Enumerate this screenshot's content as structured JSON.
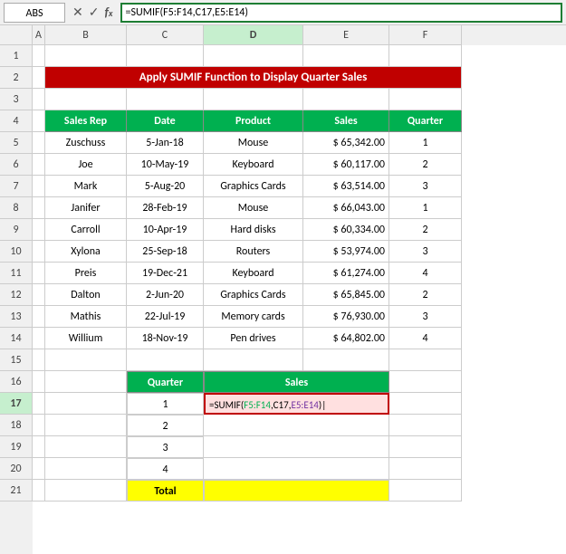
{
  "formulaBar": {
    "nameBox": "ABS",
    "formula": "=SUMIF(F5:F14,C17,E5:E14)"
  },
  "title": "Apply SUMIF Function to Display Quarter Sales",
  "columns": [
    "A",
    "B",
    "C",
    "D",
    "E",
    "F"
  ],
  "headers": {
    "salesRep": "Sales Rep",
    "date": "Date",
    "product": "Product",
    "sales": "Sales",
    "quarter": "Quarter"
  },
  "rows": [
    {
      "salesRep": "Zuschuss",
      "date": "5-Jan-18",
      "product": "Mouse",
      "sales": "$ 65,342.00",
      "quarter": "1"
    },
    {
      "salesRep": "Joe",
      "date": "10-May-19",
      "product": "Keyboard",
      "sales": "$ 60,117.00",
      "quarter": "2"
    },
    {
      "salesRep": "Mark",
      "date": "5-Aug-20",
      "product": "Graphics Cards",
      "sales": "$ 63,514.00",
      "quarter": "3"
    },
    {
      "salesRep": "Janifer",
      "date": "28-Feb-19",
      "product": "Mouse",
      "sales": "$ 66,043.00",
      "quarter": "1"
    },
    {
      "salesRep": "Carroll",
      "date": "10-Apr-19",
      "product": "Hard disks",
      "sales": "$ 60,334.00",
      "quarter": "2"
    },
    {
      "salesRep": "Xylona",
      "date": "25-Sep-18",
      "product": "Routers",
      "sales": "$ 53,974.00",
      "quarter": "3"
    },
    {
      "salesRep": "Preis",
      "date": "19-Dec-21",
      "product": "Keyboard",
      "sales": "$ 61,274.00",
      "quarter": "4"
    },
    {
      "salesRep": "Dalton",
      "date": "2-Jun-20",
      "product": "Graphics Cards",
      "sales": "$ 65,845.00",
      "quarter": "2"
    },
    {
      "salesRep": "Mathis",
      "date": "22-Jul-19",
      "product": "Memory cards",
      "sales": "$ 76,930.00",
      "quarter": "3"
    },
    {
      "salesRep": "Willium",
      "date": "18-Nov-19",
      "product": "Pen drives",
      "sales": "$ 64,802.00",
      "quarter": "4"
    }
  ],
  "bottomTable": {
    "quarterHeader": "Quarter",
    "salesHeader": "Sales",
    "quarters": [
      "1",
      "2",
      "3",
      "4"
    ],
    "totalLabel": "Total",
    "activeFormula": "=SUMIF(F5:F14,C17,E5:E14)"
  },
  "rowNumbers": [
    "1",
    "2",
    "3",
    "4",
    "5",
    "6",
    "7",
    "8",
    "9",
    "10",
    "11",
    "12",
    "13",
    "14",
    "15",
    "16",
    "17",
    "18",
    "19",
    "20",
    "21"
  ]
}
